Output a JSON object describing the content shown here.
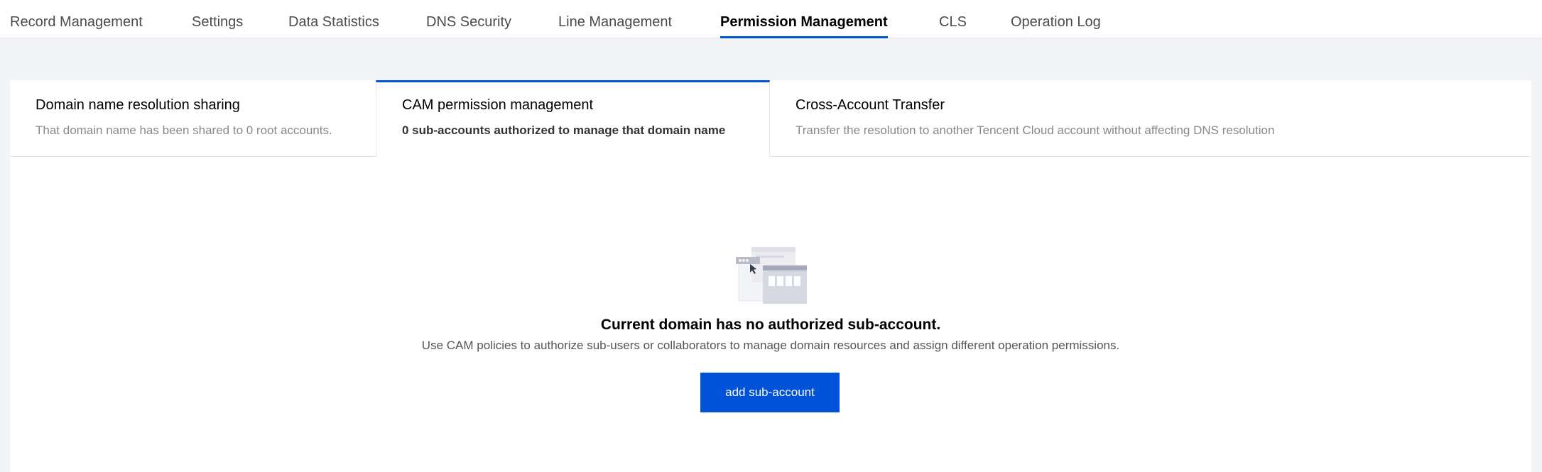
{
  "top_tabs": [
    {
      "label": "Record Management"
    },
    {
      "label": "Settings"
    },
    {
      "label": "Data Statistics"
    },
    {
      "label": "DNS Security"
    },
    {
      "label": "Line Management"
    },
    {
      "label": "Permission Management",
      "active": true
    },
    {
      "label": "CLS"
    },
    {
      "label": "Operation Log"
    }
  ],
  "sub_tabs": [
    {
      "title": "Domain name resolution sharing",
      "desc": "That domain name has been shared to 0 root accounts."
    },
    {
      "title": "CAM permission management",
      "desc": "0 sub-accounts authorized to manage that domain name",
      "active": true
    },
    {
      "title": "Cross-Account Transfer",
      "desc": "Transfer the resolution to another Tencent Cloud account without affecting DNS resolution"
    }
  ],
  "empty_state": {
    "icon": "empty-windows-illustration",
    "title": "Current domain has no authorized sub-account.",
    "desc": "Use CAM policies to authorize sub-users or collaborators to manage domain resources and assign different operation permissions.",
    "button_label": "add sub-account"
  },
  "colors": {
    "accent": "#0052d9",
    "page_bg": "#f3f4f7"
  }
}
